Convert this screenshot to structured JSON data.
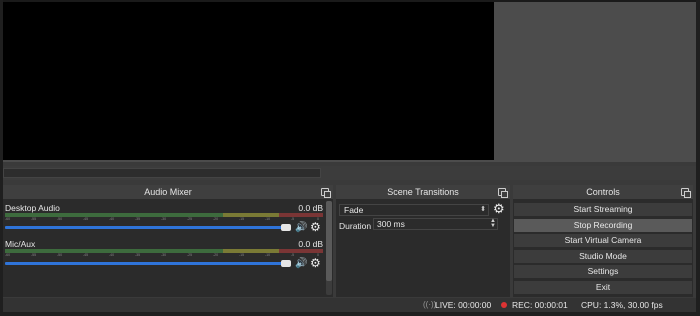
{
  "mixer": {
    "title": "Audio Mixer",
    "channels": [
      {
        "name": "Desktop Audio",
        "db": "0.0 dB"
      },
      {
        "name": "Mic/Aux",
        "db": "0.0 dB"
      }
    ],
    "ticks": [
      "-60",
      "-55",
      "-50",
      "-45",
      "-40",
      "-35",
      "-30",
      "-25",
      "-20",
      "-15",
      "-10",
      "-5",
      "0"
    ]
  },
  "transitions": {
    "title": "Scene Transitions",
    "selected": "Fade",
    "duration_label": "Duration",
    "duration_value": "300 ms"
  },
  "controls": {
    "title": "Controls",
    "buttons": [
      "Start Streaming",
      "Stop Recording",
      "Start Virtual Camera",
      "Studio Mode",
      "Settings",
      "Exit"
    ]
  },
  "status": {
    "live": "LIVE: 00:00:00",
    "rec": "REC: 00:00:01",
    "cpu": "CPU: 1.3%, 30.00 fps"
  },
  "icons": {
    "gear": "gear-icon",
    "volume": "volume-icon",
    "float": "float-dock-icon"
  },
  "colors": {
    "slider": "#2f74d9",
    "rec_dot": "#dd3333",
    "background": "#3a3a3a"
  }
}
